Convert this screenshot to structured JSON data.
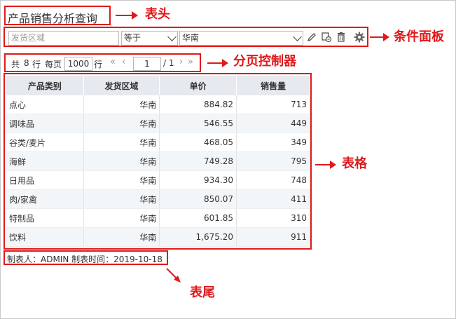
{
  "header": {
    "title": "产品销售分析查询"
  },
  "condition": {
    "field_placeholder": "发货区域",
    "operator": "等于",
    "value": "华南"
  },
  "pager": {
    "total_prefix": "共",
    "total": "8",
    "total_suffix": "行",
    "per_page_label": "每页",
    "per_page": "1000",
    "per_page_suffix": "行",
    "current_page": "1",
    "page_total": "/ 1"
  },
  "table": {
    "columns": [
      "产品类别",
      "发货区域",
      "单价",
      "销售量"
    ],
    "rows": [
      [
        "点心",
        "华南",
        "884.82",
        "713"
      ],
      [
        "调味品",
        "华南",
        "546.55",
        "449"
      ],
      [
        "谷类/麦片",
        "华南",
        "468.05",
        "349"
      ],
      [
        "海鲜",
        "华南",
        "749.28",
        "795"
      ],
      [
        "日用品",
        "华南",
        "934.30",
        "748"
      ],
      [
        "肉/家禽",
        "华南",
        "850.07",
        "411"
      ],
      [
        "特制品",
        "华南",
        "601.85",
        "310"
      ],
      [
        "饮料",
        "华南",
        "1,675.20",
        "911"
      ]
    ]
  },
  "footer": {
    "text": "制表人：ADMIN  制表时间：2019-10-18"
  },
  "annotations": {
    "header": "表头",
    "condition": "条件面板",
    "pager": "分页控制器",
    "table": "表格",
    "footer": "表尾"
  },
  "colors": {
    "annotation": "#e0191b",
    "header_bg": "#e6e9ee",
    "stripe": "#f3f6f9"
  }
}
